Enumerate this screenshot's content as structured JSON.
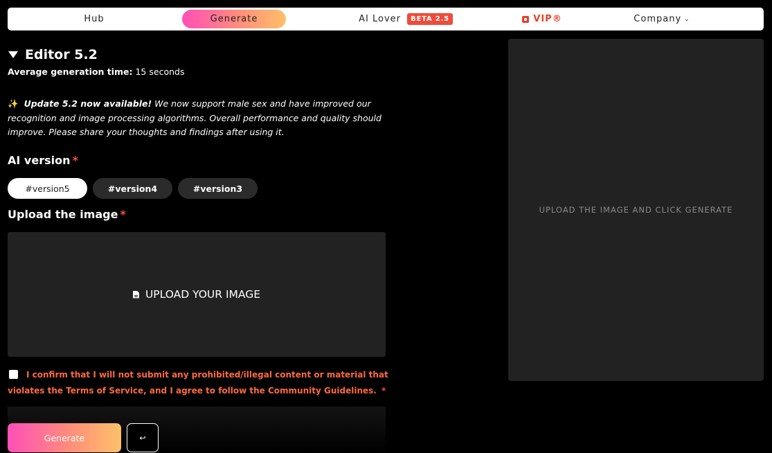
{
  "nav": {
    "hub": "Hub",
    "generate": "Generate",
    "ai_lover": "AI Lover",
    "ai_lover_badge": "BETA 2.5",
    "vip": "VIP®",
    "company": "Company",
    "company_chevron": "⌄"
  },
  "editor": {
    "title": "Editor 5.2",
    "avg_label": "Average generation time:",
    "avg_value": "15 seconds",
    "update_sparkle": "✨",
    "update_bold": "Update 5.2 now available!",
    "update_text": "We now support male sex and have improved our recognition and image processing algorithms. Overall performance and quality should improve. Please share your thoughts and findings after using it."
  },
  "ai_version": {
    "label": "AI version",
    "required": "*",
    "options": [
      "#version5",
      "#version4",
      "#version3"
    ],
    "selected": "#version5"
  },
  "upload": {
    "label": "Upload the image",
    "required": "*",
    "button": "UPLOAD YOUR IMAGE"
  },
  "confirm": {
    "text": "I confirm that I will not submit any prohibited/illegal content or material that violates the Terms of Service, and I agree to follow the Community Guidelines.",
    "required": "*",
    "checked": false
  },
  "actions": {
    "generate": "Generate",
    "return_glyph": "↩"
  },
  "preview": {
    "placeholder": "UPLOAD THE IMAGE AND CLICK GENERATE"
  },
  "colors": {
    "accent_gradient_start": "#ff4fb8",
    "accent_gradient_end": "#ffc06a",
    "warning": "#ff6a3d",
    "required": "#ff4848",
    "vip": "#e8402b"
  }
}
